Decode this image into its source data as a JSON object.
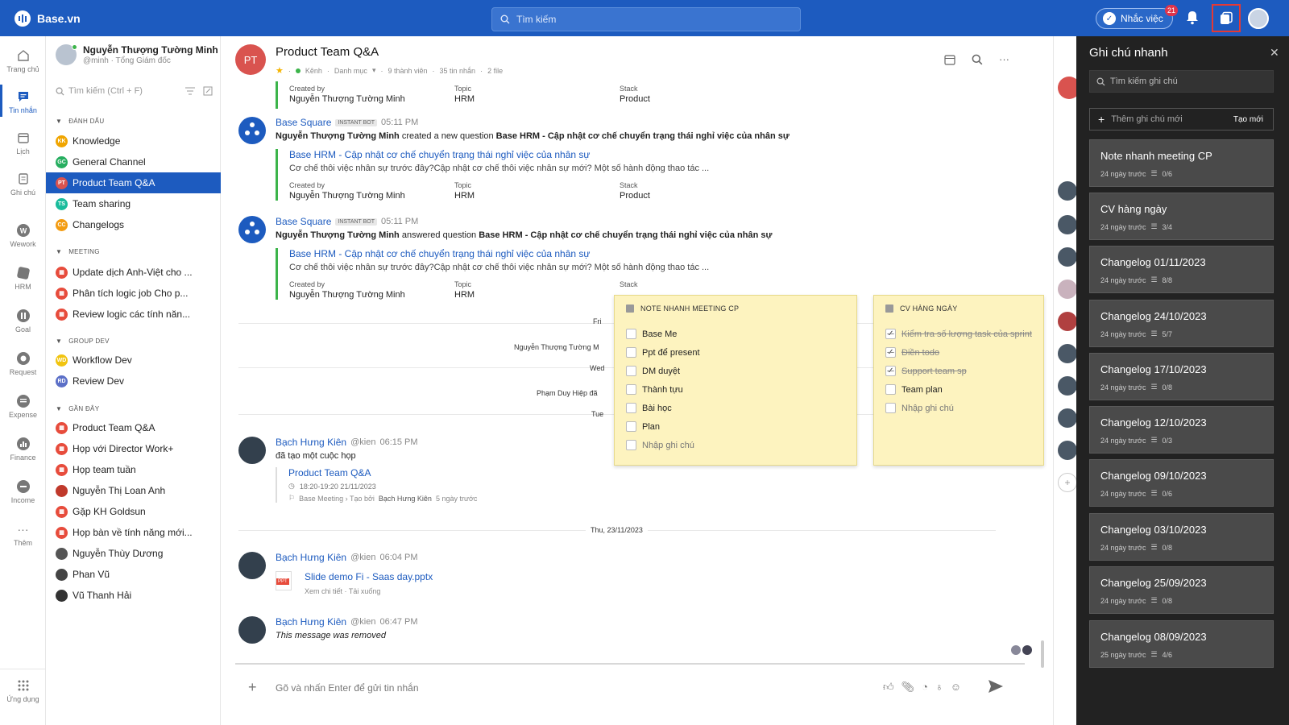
{
  "topbar": {
    "brand": "Base.vn",
    "search_placeholder": "Tìm kiếm",
    "reminder_label": "Nhắc việc",
    "reminder_badge": "21"
  },
  "leftnav": [
    {
      "label": "Trang chủ",
      "icon": "home-icon"
    },
    {
      "label": "Tin nhắn",
      "icon": "message-icon",
      "active": true
    },
    {
      "label": "Lịch",
      "icon": "calendar-icon"
    },
    {
      "label": "Ghi chú",
      "icon": "note-icon"
    },
    {
      "label": "Wework",
      "icon": "wework-icon"
    },
    {
      "label": "HRM",
      "icon": "hrm-icon"
    },
    {
      "label": "Goal",
      "icon": "goal-icon"
    },
    {
      "label": "Request",
      "icon": "request-icon"
    },
    {
      "label": "Expense",
      "icon": "expense-icon"
    },
    {
      "label": "Finance",
      "icon": "finance-icon"
    },
    {
      "label": "Income",
      "icon": "income-icon"
    },
    {
      "label": "Thêm",
      "icon": "more-icon"
    },
    {
      "label": "Ứng dụng",
      "icon": "apps-grid-icon"
    }
  ],
  "sidebar": {
    "user_name": "Nguyễn Thượng Tường Minh",
    "user_sub": "@minh · Tổng Giám đốc",
    "search_placeholder": "Tìm kiếm (Ctrl + F)",
    "groups": [
      {
        "title": "ĐÁNH DẤU",
        "items": [
          {
            "label": "Knowledge",
            "abbr": "KK",
            "color": "#f0a500"
          },
          {
            "label": "General Channel",
            "abbr": "GC",
            "color": "#27ae60"
          },
          {
            "label": "Product Team Q&A",
            "abbr": "PT",
            "color": "#d9534f",
            "active": true
          },
          {
            "label": "Team sharing",
            "abbr": "TS",
            "color": "#1abc9c"
          },
          {
            "label": "Changelogs",
            "abbr": "CC",
            "color": "#f39c12"
          }
        ]
      },
      {
        "title": "MEETING",
        "items": [
          {
            "label": "Update dịch Anh-Việt cho ...",
            "abbr": "",
            "color": "#e74c3c"
          },
          {
            "label": "Phân tích logic job Cho p...",
            "abbr": "",
            "color": "#e74c3c"
          },
          {
            "label": "Review logic các tính năn...",
            "abbr": "",
            "color": "#e74c3c"
          }
        ]
      },
      {
        "title": "GROUP DEV",
        "items": [
          {
            "label": "Workflow Dev",
            "abbr": "WD",
            "color": "#f1c40f"
          },
          {
            "label": "Review Dev",
            "abbr": "RD",
            "color": "#5b6fc7"
          }
        ]
      },
      {
        "title": "GẦN ĐÂY",
        "items": [
          {
            "label": "Product Team Q&A",
            "abbr": "",
            "color": "#e74c3c"
          },
          {
            "label": "Họp với Director Work+",
            "abbr": "",
            "color": "#e74c3c"
          },
          {
            "label": "Họp team tuần",
            "abbr": "",
            "color": "#e74c3c"
          },
          {
            "label": "Nguyễn Thị Loan Anh",
            "abbr": "",
            "color": "#c0392b"
          },
          {
            "label": "Gặp KH Goldsun",
            "abbr": "",
            "color": "#e74c3c"
          },
          {
            "label": "Họp bàn về tính năng mới...",
            "abbr": "",
            "color": "#e74c3c"
          },
          {
            "label": "Nguyễn Thùy Dương",
            "abbr": "",
            "color": "#555"
          },
          {
            "label": "Phan Vũ",
            "abbr": "",
            "color": "#444"
          },
          {
            "label": "Vũ Thanh Hải",
            "abbr": "",
            "color": "#333"
          }
        ]
      }
    ]
  },
  "channel": {
    "avatar": "PT",
    "title": "Product Team Q&A",
    "kind": "Kênh",
    "category": "Danh mục",
    "members": "9 thành viên",
    "messages": "35 tin nhắn",
    "files": "2 file"
  },
  "messages": {
    "top_card": {
      "k1": "Created by",
      "v1": "Nguyễn Thượng Tường Minh",
      "k2": "Topic",
      "v2": "HRM",
      "k3": "Stack",
      "v3": "Product"
    },
    "m1": {
      "sender": "Base Square",
      "tag": "INSTANT BOT",
      "time": "05:11 PM",
      "actor": "Nguyễn Thượng Tường Minh",
      "action": " created a new question ",
      "subject": "Base HRM - Cập nhật cơ chế chuyển trạng thái nghỉ việc của nhân sự",
      "link": "Base HRM - Cập nhật cơ chế chuyển trạng thái nghỉ việc của nhân sự",
      "desc": "Cơ chế thôi việc nhân sự trước đây?Cập nhật cơ chế thôi việc nhân sự mới? Một số hành động thao tác ...",
      "k1": "Created by",
      "v1": "Nguyễn Thượng Tường Minh",
      "k2": "Topic",
      "v2": "HRM",
      "k3": "Stack",
      "v3": "Product"
    },
    "m2": {
      "sender": "Base Square",
      "tag": "INSTANT BOT",
      "time": "05:11 PM",
      "actor": "Nguyễn Thượng Tường Minh",
      "action": " answered question ",
      "subject": "Base HRM - Cập nhật cơ chế chuyển trạng thái nghỉ việc của nhân sự",
      "link": "Base HRM - Cập nhật cơ chế chuyển trạng thái nghỉ việc của nhân sự",
      "desc": "Cơ chế thôi việc nhân sự trước đây?Cập nhật cơ chế thôi việc nhân sự mới? Một số hành động thao tác ...",
      "k1": "Created by",
      "v1": "Nguyễn Thượng Tường Minh",
      "k2": "Topic",
      "v2": "HRM",
      "k3": "Stack"
    },
    "partials": {
      "p1": "Fri",
      "p2": "Nguyễn Thượng Tường M",
      "p3": "Wed",
      "p4": "Phạm Duy Hiệp đã",
      "p5": "Tue"
    },
    "m3": {
      "sender": "Bạch Hưng Kiên",
      "handle": "@kien",
      "time": "06:15 PM",
      "body": "đã tạo một cuộc họp",
      "link": "Product Team Q&A",
      "when": "18:20-19:20 21/11/2023",
      "meta": "Base Meeting › Tạo bởi",
      "meta_by": "Bạch Hưng Kiên",
      "meta_ago": "5 ngày trước"
    },
    "day_label": "Thu, 23/11/2023",
    "m4": {
      "sender": "Bạch Hưng Kiên",
      "handle": "@kien",
      "time": "06:04 PM",
      "file": "Slide demo Fi - Saas day.pptx",
      "file_actions": "Xem chi tiết · Tải xuống",
      "file_type": "PPT"
    },
    "m5": {
      "sender": "Bạch Hưng Kiên",
      "handle": "@kien",
      "time": "06:47 PM",
      "body": "This message was removed"
    }
  },
  "composer": {
    "placeholder": "Gõ và nhấn Enter để gửi tin nhắn"
  },
  "popups": {
    "note1": {
      "title": "NOTE NHANH MEETING CP",
      "items": [
        {
          "text": "Base Me",
          "done": false
        },
        {
          "text": "Ppt để present",
          "done": false
        },
        {
          "text": "DM duyệt",
          "done": false
        },
        {
          "text": "Thành tựu",
          "done": false
        },
        {
          "text": "Bài học",
          "done": false
        },
        {
          "text": "Plan",
          "done": false
        }
      ],
      "placeholder": "Nhập ghi chú"
    },
    "note2": {
      "title": "CV HÀNG NGÀY",
      "items": [
        {
          "text": "Kiểm tra số lượng task của sprint",
          "done": true
        },
        {
          "text": "Điền todo",
          "done": true
        },
        {
          "text": "Support team sp",
          "done": true
        },
        {
          "text": "Team plan",
          "done": false
        }
      ],
      "placeholder": "Nhập ghi chú"
    }
  },
  "quicknotes": {
    "title": "Ghi chú nhanh",
    "search_placeholder": "Tìm kiếm ghi chú",
    "add_placeholder": "Thêm ghi chú mới",
    "create_label": "Tạo mới",
    "notes": [
      {
        "title": "Note nhanh meeting CP",
        "ago": "24 ngày trước",
        "count": "0/6"
      },
      {
        "title": "CV hàng ngày",
        "ago": "24 ngày trước",
        "count": "3/4"
      },
      {
        "title": "Changelog 01/11/2023",
        "ago": "24 ngày trước",
        "count": "8/8"
      },
      {
        "title": "Changelog 24/10/2023",
        "ago": "24 ngày trước",
        "count": "5/7"
      },
      {
        "title": "Changelog 17/10/2023",
        "ago": "24 ngày trước",
        "count": "0/8"
      },
      {
        "title": "Changelog 12/10/2023",
        "ago": "24 ngày trước",
        "count": "0/3"
      },
      {
        "title": "Changelog 09/10/2023",
        "ago": "24 ngày trước",
        "count": "0/6"
      },
      {
        "title": "Changelog 03/10/2023",
        "ago": "24 ngày trước",
        "count": "0/8"
      },
      {
        "title": "Changelog 25/09/2023",
        "ago": "24 ngày trước",
        "count": "0/8"
      },
      {
        "title": "Changelog 08/09/2023",
        "ago": "25 ngày trước",
        "count": "4/6"
      }
    ]
  }
}
